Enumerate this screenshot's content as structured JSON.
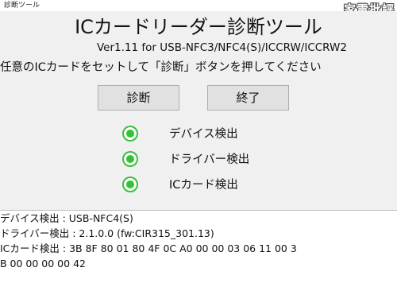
{
  "window": {
    "title": "診断ツール",
    "watermark": "家電批評"
  },
  "app": {
    "title": "ICカードリーダー診断ツール",
    "version": "Ver1.11 for USB-NFC3/NFC4(S)/ICCRW/ICCRW2",
    "instruction": "任意のICカードをセットして「診断」ボタンを押してください"
  },
  "buttons": {
    "diagnose": "診断",
    "exit": "終了"
  },
  "status": {
    "color": "#35c03a",
    "items": [
      {
        "label": "デバイス検出",
        "icon": "success-ring-icon"
      },
      {
        "label": "ドライバー検出",
        "icon": "success-ring-icon"
      },
      {
        "label": "ICカード検出",
        "icon": "success-ring-icon"
      }
    ]
  },
  "log": {
    "lines": [
      "デバイス検出 : USB-NFC4(S)",
      "ドライバー検出 : 2.1.0.0 (fw:CIR315_301.13)",
      "ICカード検出 : 3B 8F 80 01 80 4F 0C A0 00 00 03 06 11 00 3",
      "B 00 00 00 00 42"
    ]
  }
}
